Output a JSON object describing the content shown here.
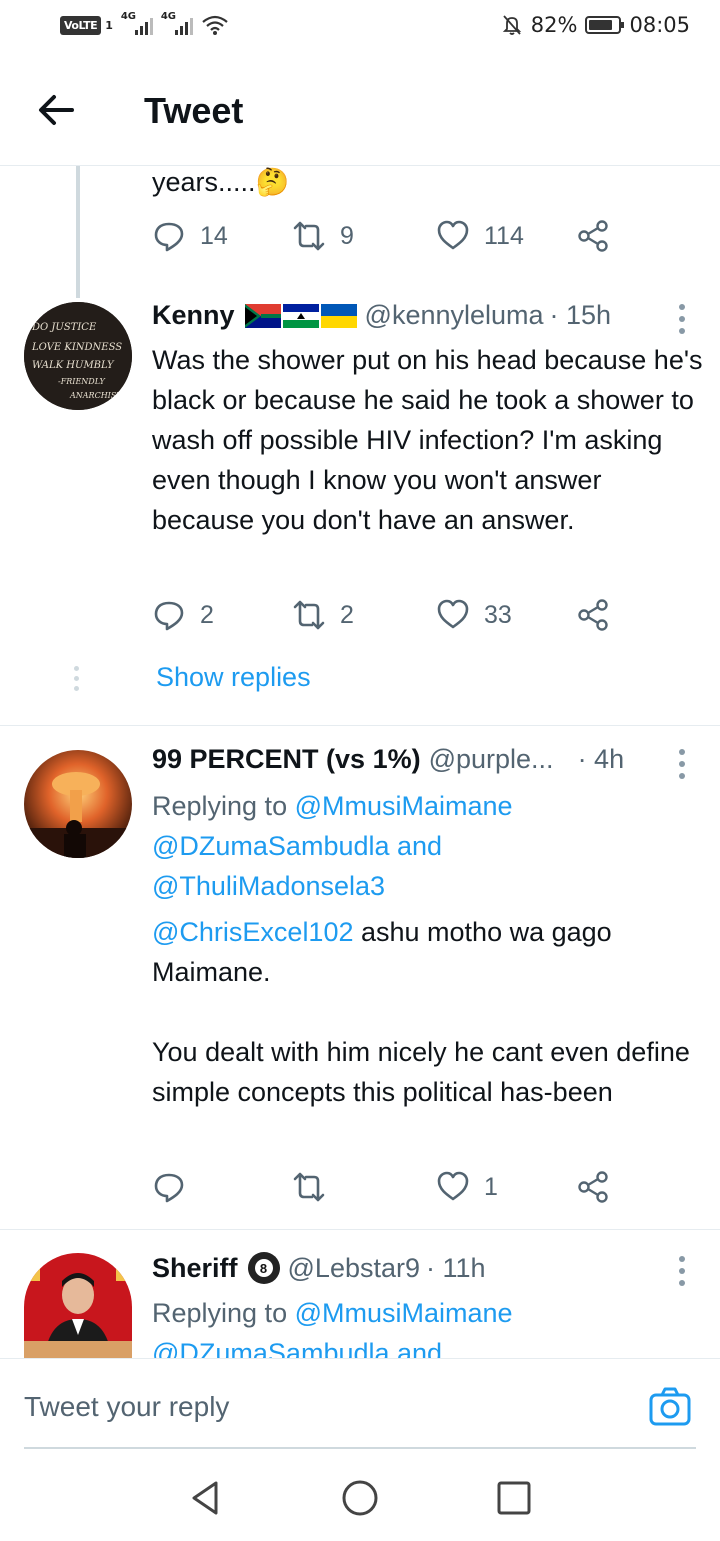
{
  "status": {
    "volte": "VoLTE",
    "sim": "1",
    "net1": "4G",
    "net2": "4G",
    "battery_pct": "82%",
    "battery_level": 0.82,
    "time": "08:05",
    "icons": [
      "signal-icon",
      "wifi-icon",
      "mute-icon",
      "battery-icon"
    ]
  },
  "header": {
    "title": "Tweet",
    "back_icon": "arrow-left-icon"
  },
  "prev_tweet": {
    "text_tail": "years.....",
    "emoji": "🤔",
    "replies": "14",
    "retweets": "9",
    "likes": "114"
  },
  "tweets": [
    {
      "name": "Kenny",
      "flags": "🇿🇦🇱🇸🇺🇦",
      "handle": "@kennyleluma",
      "time": "· 15h",
      "avatar_lines": [
        "DO JUSTICE",
        "LOVE KINDNESS",
        "WALK HUMBLY",
        "-FRIENDLY",
        "ANARCHIST"
      ],
      "text": "Was the shower put on his head because he's  black or because he said he took a shower to wash off possible HIV infection? I'm asking even though I know you won't answer because you don't have an answer.",
      "replies": "2",
      "retweets": "2",
      "likes": "33",
      "show_replies": "Show replies"
    },
    {
      "name": "99 PERCENT (vs 1%)",
      "handle": "@purple...",
      "time": "· 4h",
      "replying_prefix": "Replying to ",
      "replying_1": "@MmusiMaimane",
      "replying_2": "@DZumaSambudla",
      "replying_and": " and",
      "replying_3": "@ThuliMadonsela3",
      "mention": "@ChrisExcel102",
      "text_1": " ashu motho wa gago Maimane.",
      "text_2": "You dealt with him nicely he cant even define simple concepts this political has-been",
      "likes": "1"
    },
    {
      "name": "Sheriff",
      "badge": "8",
      "handle": "@Lebstar9",
      "time": "· 11h",
      "replying_prefix": "Replying to ",
      "replying_1": "@MmusiMaimane",
      "replying_2": "@DZumaSambudla and"
    }
  ],
  "reply_bar": {
    "placeholder": "Tweet your reply",
    "camera_icon": "camera-icon"
  },
  "colors": {
    "accent": "#1d9bf0",
    "text": "#0f1419",
    "muted": "#536471",
    "divider": "#e6ecf0"
  }
}
